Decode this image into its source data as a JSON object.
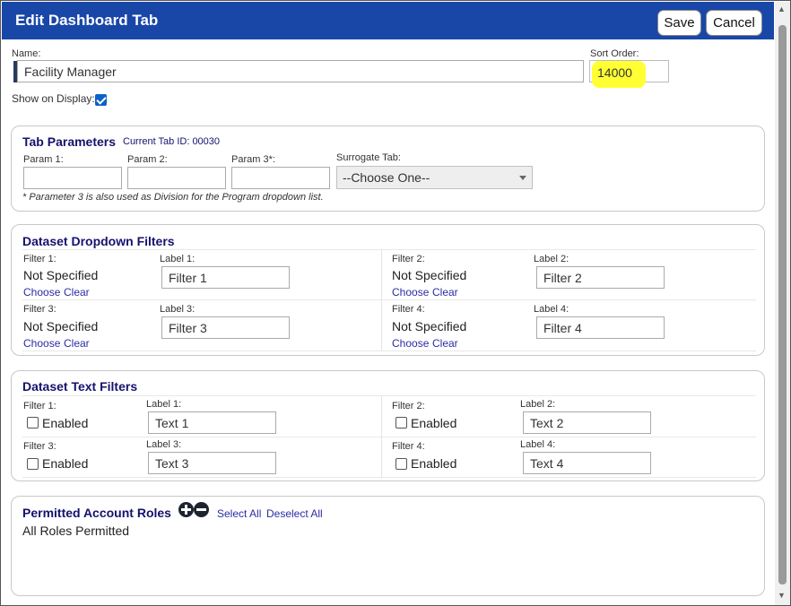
{
  "dialog": {
    "title": "Edit Dashboard Tab",
    "save_label": "Save",
    "cancel_label": "Cancel"
  },
  "general": {
    "name_label": "Name:",
    "name_value": "Facility Manager",
    "sort_order_label": "Sort Order:",
    "sort_order_value": "14000",
    "show_on_display_label": "Show on Display:",
    "show_on_display_checked": true
  },
  "tab_parameters": {
    "title": "Tab Parameters",
    "current_tab_id": "Current Tab ID: 00030",
    "params": [
      {
        "label": "Param 1:",
        "value": ""
      },
      {
        "label": "Param 2:",
        "value": ""
      },
      {
        "label": "Param 3*:",
        "value": ""
      }
    ],
    "surrogate_label": "Surrogate Tab:",
    "surrogate_value": "--Choose One--",
    "footnote": "* Parameter 3 is also used as Division for the Program dropdown list."
  },
  "dropdown_filters": {
    "title": "Dataset Dropdown Filters",
    "choose_label": "Choose",
    "clear_label": "Clear",
    "filters": [
      {
        "filter_label": "Filter 1:",
        "value": "Not Specified",
        "label_label": "Label 1:",
        "label_value": "Filter 1"
      },
      {
        "filter_label": "Filter 2:",
        "value": "Not Specified",
        "label_label": "Label 2:",
        "label_value": "Filter 2"
      },
      {
        "filter_label": "Filter 3:",
        "value": "Not Specified",
        "label_label": "Label 3:",
        "label_value": "Filter 3"
      },
      {
        "filter_label": "Filter 4:",
        "value": "Not Specified",
        "label_label": "Label 4:",
        "label_value": "Filter 4"
      }
    ]
  },
  "text_filters": {
    "title": "Dataset Text Filters",
    "enabled_label": "Enabled",
    "filters": [
      {
        "filter_label": "Filter 1:",
        "label_label": "Label 1:",
        "label_value": "Text 1",
        "enabled": false
      },
      {
        "filter_label": "Filter 2:",
        "label_label": "Label 2:",
        "label_value": "Text 2",
        "enabled": false
      },
      {
        "filter_label": "Filter 3:",
        "label_label": "Label 3:",
        "label_value": "Text 3",
        "enabled": false
      },
      {
        "filter_label": "Filter 4:",
        "label_label": "Label 4:",
        "label_value": "Text 4",
        "enabled": false
      }
    ]
  },
  "account_roles": {
    "title": "Permitted Account Roles",
    "select_all": "Select All",
    "deselect_all": "Deselect All",
    "status": "All Roles Permitted"
  },
  "colors": {
    "title_bar": "#1947a8",
    "section_title": "#14126d",
    "link": "#2b2ba8",
    "highlight": "#ffff33",
    "checkbox_checked": "#0b62c9"
  }
}
